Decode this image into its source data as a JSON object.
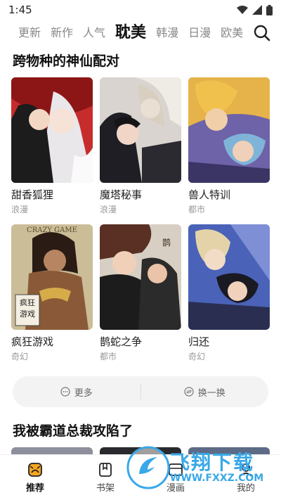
{
  "status": {
    "time": "1:45"
  },
  "tabs": [
    {
      "label": "更新"
    },
    {
      "label": "新作"
    },
    {
      "label": "人气"
    },
    {
      "label": "耽美",
      "active": true
    },
    {
      "label": "韩漫"
    },
    {
      "label": "日漫"
    },
    {
      "label": "欧美"
    }
  ],
  "section1": {
    "title": "跨物种的神仙配对",
    "items": [
      {
        "title": "甜香狐狸",
        "tag": "浪漫",
        "cover_text": ""
      },
      {
        "title": "魔塔秘事",
        "tag": "浪漫",
        "cover_text": ""
      },
      {
        "title": "兽人特训",
        "tag": "都市",
        "cover_text": ""
      },
      {
        "title": "疯狂游戏",
        "tag": "奇幻",
        "cover_text": "CRAZY GAME",
        "cover_text2": "疯狂游戏"
      },
      {
        "title": "鹊蛇之争",
        "tag": "都市",
        "cover_text": ""
      },
      {
        "title": "归还",
        "tag": "奇幻",
        "cover_text": ""
      }
    ]
  },
  "actions": {
    "more": "更多",
    "refresh": "换一换"
  },
  "section2": {
    "title": "我被霸道总裁攻陷了"
  },
  "nav": [
    {
      "label": "推荐",
      "active": true
    },
    {
      "label": "书架"
    },
    {
      "label": "漫画"
    },
    {
      "label": "我的"
    }
  ],
  "watermark": {
    "text": "飞翔下载",
    "url": "WWW.FXXZ.COM"
  },
  "colors": {
    "accent": "#111111",
    "muted": "#999999",
    "pill_bg": "#f3f3f3",
    "watermark": "#39a8e8"
  }
}
